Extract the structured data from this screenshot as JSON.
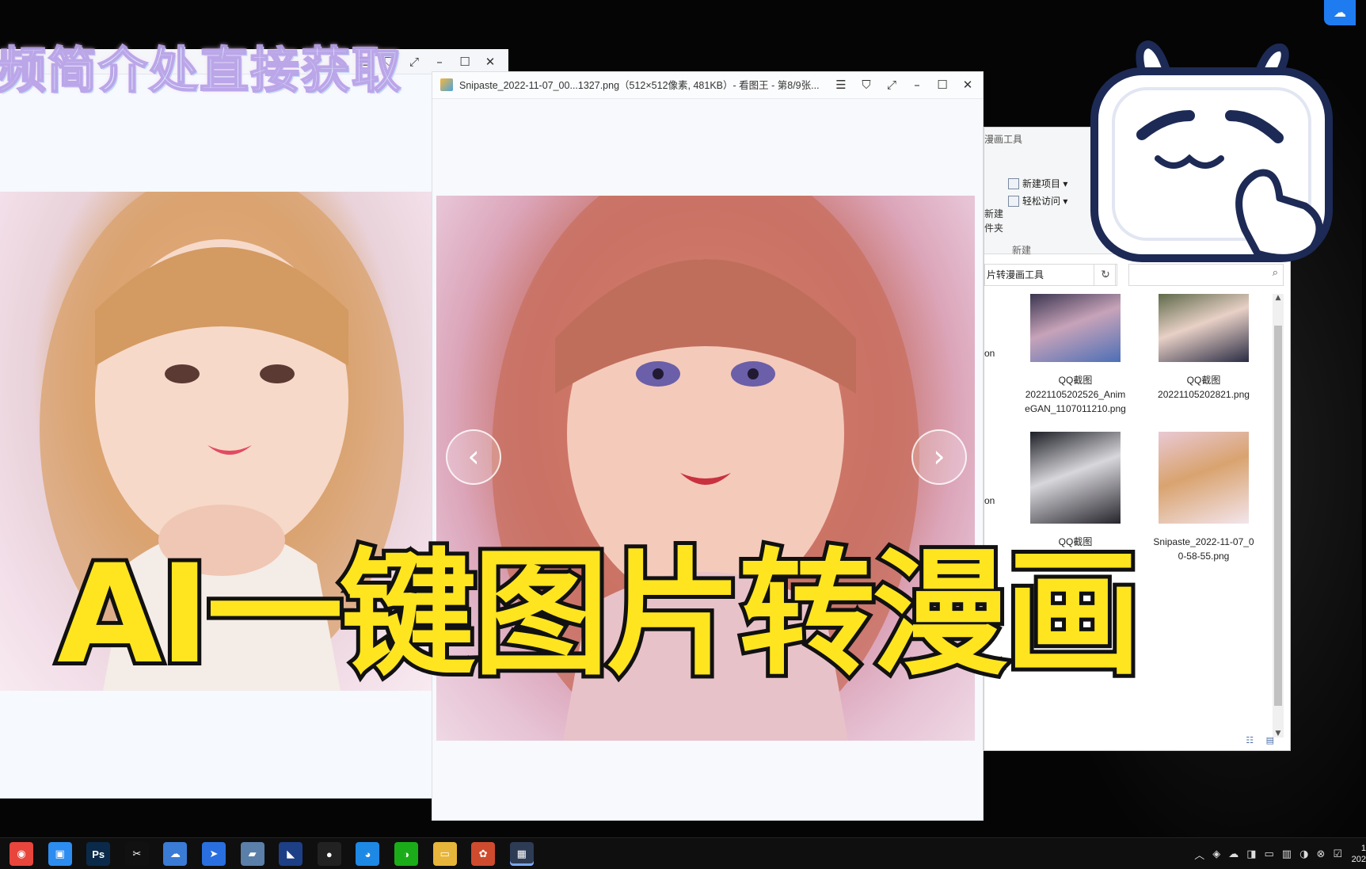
{
  "top_caption": "频简介处直接获取",
  "headline": "AI一键图片转漫画",
  "left_window": {
    "controls": [
      "☰",
      "⛉",
      "⤢",
      "–",
      "☐",
      "✕"
    ]
  },
  "center_window": {
    "title": "Snipaste_2022-11-07_00...1327.png（512×512像素, 481KB）- 看图王 - 第8/9张...",
    "controls": [
      "☰",
      "⛉",
      "⤢",
      "–",
      "☐",
      "✕"
    ],
    "prev_arrow": "‹",
    "next_arrow": "›"
  },
  "explorer": {
    "ribbon_tab": "漫画工具",
    "new_item": "新建项目 ▾",
    "easy_access": "轻松访问 ▾",
    "side_new": "新建",
    "side_folder": "件夹",
    "group_label": "新建",
    "address": "片转漫画工具",
    "address_chevron": "⌄",
    "refresh": "↻",
    "search_icon": "⌕",
    "cut_label_1": "on",
    "cut_label_2": "on",
    "files": [
      {
        "name": "QQ截图\n20221105202526_AnimeGAN_1107011210.png"
      },
      {
        "name": "QQ截图\n20221105202821.png"
      },
      {
        "name": "QQ截图\n20221105203148_Ani"
      },
      {
        "name": "Snipaste_2022-11-07_00-58-55.png"
      }
    ],
    "scroll_up": "▲",
    "scroll_down": "▼",
    "view_buttons": "☷ ▤"
  },
  "badge_icon": "☁",
  "taskbar": {
    "icons": [
      {
        "name": "chrome-icon",
        "glyph": "◉",
        "color": "#e8453c"
      },
      {
        "name": "file-manager-icon",
        "glyph": "▣",
        "color": "#2d8cf0"
      },
      {
        "name": "photoshop-icon",
        "glyph": "Ps",
        "color": "#0b2a4a"
      },
      {
        "name": "capcut-icon",
        "glyph": "✂",
        "color": "#111111"
      },
      {
        "name": "baidu-netdisk-icon",
        "glyph": "☁",
        "color": "#3a7bd5"
      },
      {
        "name": "feishu-icon",
        "glyph": "➤",
        "color": "#2a6fe0"
      },
      {
        "name": "notes-icon",
        "glyph": "▰",
        "color": "#5a7fa8"
      },
      {
        "name": "visual-studio-icon",
        "glyph": "◣",
        "color": "#1d3f86"
      },
      {
        "name": "record-icon",
        "glyph": "●",
        "color": "#222222"
      },
      {
        "name": "qq-icon",
        "glyph": "◕",
        "color": "#1e88e5"
      },
      {
        "name": "wechat-icon",
        "glyph": "◑",
        "color": "#1aad19"
      },
      {
        "name": "folder-icon",
        "glyph": "▭",
        "color": "#e7b53a"
      },
      {
        "name": "flower-app-icon",
        "glyph": "✿",
        "color": "#cf4b2e"
      },
      {
        "name": "image-viewer-icon",
        "glyph": "▦",
        "color": "#f2c230"
      }
    ],
    "tray": [
      "︿",
      "◈",
      "☁",
      "◨",
      "▭",
      "▥",
      "◑",
      "⊗",
      "☑"
    ],
    "clock": "1\n202"
  }
}
